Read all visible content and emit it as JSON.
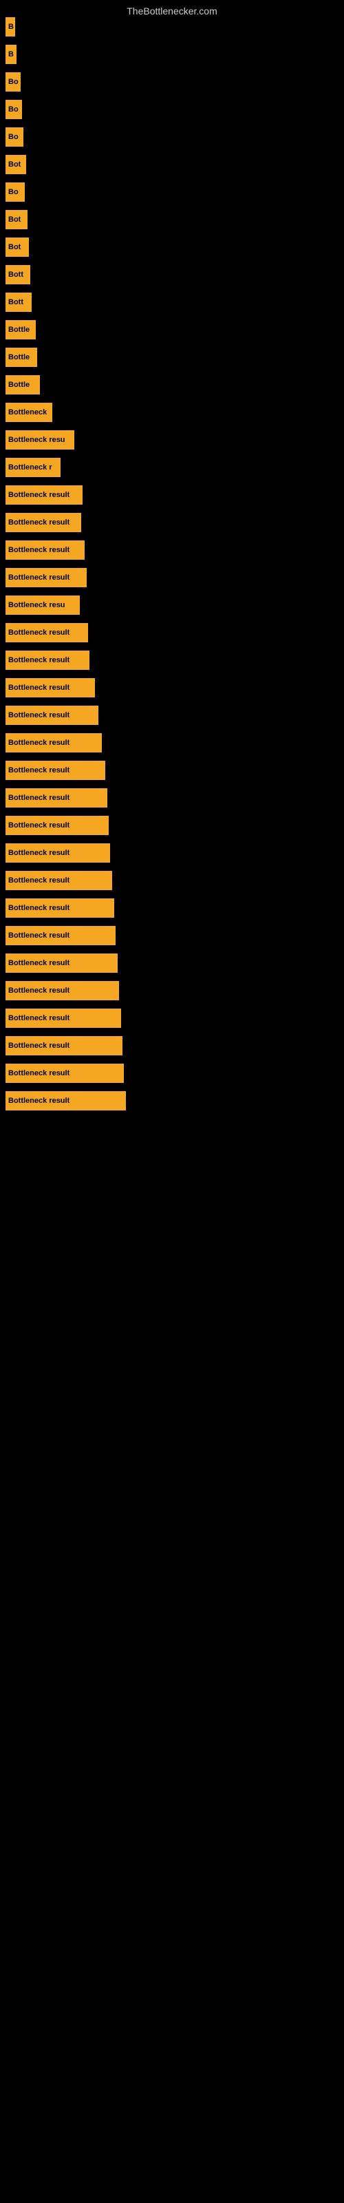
{
  "site": {
    "title": "TheBottlenecker.com"
  },
  "bars": [
    {
      "label": "B",
      "width": 14
    },
    {
      "label": "B",
      "width": 16
    },
    {
      "label": "Bo",
      "width": 22
    },
    {
      "label": "Bo",
      "width": 24
    },
    {
      "label": "Bo",
      "width": 26
    },
    {
      "label": "Bot",
      "width": 30
    },
    {
      "label": "Bo",
      "width": 28
    },
    {
      "label": "Bot",
      "width": 32
    },
    {
      "label": "Bot",
      "width": 34
    },
    {
      "label": "Bott",
      "width": 36
    },
    {
      "label": "Bott",
      "width": 38
    },
    {
      "label": "Bottle",
      "width": 44
    },
    {
      "label": "Bottle",
      "width": 46
    },
    {
      "label": "Bottle",
      "width": 50
    },
    {
      "label": "Bottleneck",
      "width": 68
    },
    {
      "label": "Bottleneck resu",
      "width": 100
    },
    {
      "label": "Bottleneck r",
      "width": 80
    },
    {
      "label": "Bottleneck result",
      "width": 112
    },
    {
      "label": "Bottleneck result",
      "width": 110
    },
    {
      "label": "Bottleneck result",
      "width": 115
    },
    {
      "label": "Bottleneck result",
      "width": 118
    },
    {
      "label": "Bottleneck resu",
      "width": 108
    },
    {
      "label": "Bottleneck result",
      "width": 120
    },
    {
      "label": "Bottleneck result",
      "width": 122
    },
    {
      "label": "Bottleneck result",
      "width": 130
    },
    {
      "label": "Bottleneck result",
      "width": 135
    },
    {
      "label": "Bottleneck result",
      "width": 140
    },
    {
      "label": "Bottleneck result",
      "width": 145
    },
    {
      "label": "Bottleneck result",
      "width": 148
    },
    {
      "label": "Bottleneck result",
      "width": 150
    },
    {
      "label": "Bottleneck result",
      "width": 152
    },
    {
      "label": "Bottleneck result",
      "width": 155
    },
    {
      "label": "Bottleneck result",
      "width": 158
    },
    {
      "label": "Bottleneck result",
      "width": 160
    },
    {
      "label": "Bottleneck result",
      "width": 163
    },
    {
      "label": "Bottleneck result",
      "width": 165
    },
    {
      "label": "Bottleneck result",
      "width": 168
    },
    {
      "label": "Bottleneck result",
      "width": 170
    },
    {
      "label": "Bottleneck result",
      "width": 172
    },
    {
      "label": "Bottleneck result",
      "width": 175
    }
  ]
}
